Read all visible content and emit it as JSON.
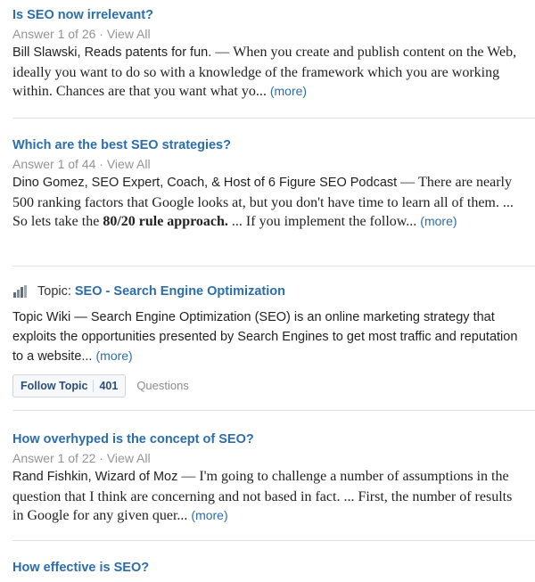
{
  "items": [
    {
      "title": "Is SEO now irrelevant?",
      "answer_info": "Answer 1 of 26",
      "view_all": "View All",
      "author": "Bill Slawski, Reads patents for fun.",
      "excerpt": "When you create and publish content on the Web, ideally you want to do so with a knowledge of the framework which you are working within.  Chances are that you want what yo...",
      "more": "(more)"
    },
    {
      "title": "Which are the best SEO strategies?",
      "answer_info": "Answer 1 of 44",
      "view_all": "View All",
      "author": "Dino Gomez, SEO Expert, Coach, & Host of 6 Figure SEO Podcast",
      "excerpt_before": "There are nearly 500 ranking factors that Google looks at, but you don't have time to learn all of them. ... So lets take the",
      "excerpt_bold": "80/20 rule approach.",
      "excerpt_after": "... If you implement the follow...",
      "more": "(more)"
    },
    {
      "title": "How overhyped is the concept of SEO?",
      "answer_info": "Answer 1 of 22",
      "view_all": "View All",
      "author": "Rand Fishkin, Wizard of Moz",
      "excerpt": "I'm going to challenge a number of assumptions in the question that I think are concerning and not based in fact. ... First, the number of results in Google for any given quer...",
      "more": "(more)"
    },
    {
      "title": "How effective is SEO?"
    }
  ],
  "topic": {
    "prefix": "Topic:",
    "name": "SEO - Search Engine Optimization",
    "wiki_label": "Topic Wiki",
    "excerpt": "Search Engine Optimization (SEO) is an online marketing strategy that exploits the opportunities presented by Search Engines to get most traffic and reputation to a website...",
    "more": "(more)",
    "follow_label": "Follow Topic",
    "follow_count": "401",
    "questions_label": "Questions",
    "icon": "topic-chart-icon"
  },
  "separators": {
    "dot": "·",
    "dash": "—"
  },
  "colors": {
    "link": "#2b6dad",
    "meta": "#949494",
    "text": "#222222",
    "divider": "#e2e2e2"
  }
}
